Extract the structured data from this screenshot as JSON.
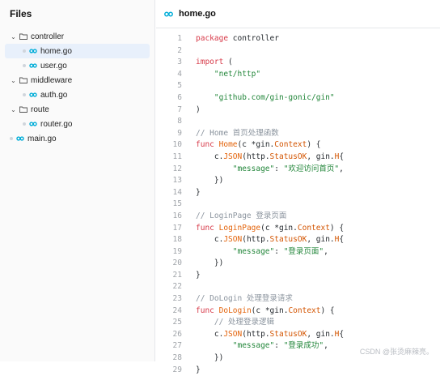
{
  "sidebar": {
    "title": "Files",
    "tree": [
      {
        "kind": "folder",
        "label": "controller",
        "depth": 0,
        "expanded": true
      },
      {
        "kind": "file",
        "label": "home.go",
        "depth": 1,
        "selected": true
      },
      {
        "kind": "file",
        "label": "user.go",
        "depth": 1
      },
      {
        "kind": "folder",
        "label": "middleware",
        "depth": 0,
        "expanded": true
      },
      {
        "kind": "file",
        "label": "auth.go",
        "depth": 1
      },
      {
        "kind": "folder",
        "label": "route",
        "depth": 0,
        "expanded": true
      },
      {
        "kind": "file",
        "label": "router.go",
        "depth": 1
      },
      {
        "kind": "file",
        "label": "main.go",
        "depth": 0
      }
    ]
  },
  "editor": {
    "tab_title": "home.go",
    "lines": [
      [
        [
          "kw",
          "package"
        ],
        [
          "",
          " controller"
        ]
      ],
      [],
      [
        [
          "kw",
          "import"
        ],
        [
          "",
          " ("
        ]
      ],
      [
        [
          "",
          "    "
        ],
        [
          "str",
          "\"net/http\""
        ]
      ],
      [],
      [
        [
          "",
          "    "
        ],
        [
          "str",
          "\"github.com/gin-gonic/gin\""
        ]
      ],
      [
        [
          "",
          ")"
        ]
      ],
      [],
      [
        [
          "cm",
          "// Home 首页处理函数"
        ]
      ],
      [
        [
          "kw",
          "func"
        ],
        [
          "",
          " "
        ],
        [
          "fn",
          "Home"
        ],
        [
          "",
          "(c *gin."
        ],
        [
          "ty",
          "Context"
        ],
        [
          "",
          ") {"
        ]
      ],
      [
        [
          "",
          "    c."
        ],
        [
          "fn",
          "JSON"
        ],
        [
          "",
          "(http."
        ],
        [
          "ty",
          "StatusOK"
        ],
        [
          "",
          ", gin."
        ],
        [
          "ty",
          "H"
        ],
        [
          "",
          "{"
        ]
      ],
      [
        [
          "",
          "        "
        ],
        [
          "str",
          "\"message\""
        ],
        [
          "",
          ": "
        ],
        [
          "str",
          "\"欢迎访问首页\""
        ],
        [
          "",
          ","
        ]
      ],
      [
        [
          "",
          "    })"
        ]
      ],
      [
        [
          "",
          "}"
        ]
      ],
      [],
      [
        [
          "cm",
          "// LoginPage 登录页面"
        ]
      ],
      [
        [
          "kw",
          "func"
        ],
        [
          "",
          " "
        ],
        [
          "fn",
          "LoginPage"
        ],
        [
          "",
          "(c *gin."
        ],
        [
          "ty",
          "Context"
        ],
        [
          "",
          ") {"
        ]
      ],
      [
        [
          "",
          "    c."
        ],
        [
          "fn",
          "JSON"
        ],
        [
          "",
          "(http."
        ],
        [
          "ty",
          "StatusOK"
        ],
        [
          "",
          ", gin."
        ],
        [
          "ty",
          "H"
        ],
        [
          "",
          "{"
        ]
      ],
      [
        [
          "",
          "        "
        ],
        [
          "str",
          "\"message\""
        ],
        [
          "",
          ": "
        ],
        [
          "str",
          "\"登录页面\""
        ],
        [
          "",
          ","
        ]
      ],
      [
        [
          "",
          "    })"
        ]
      ],
      [
        [
          "",
          "}"
        ]
      ],
      [],
      [
        [
          "cm",
          "// DoLogin 处理登录请求"
        ]
      ],
      [
        [
          "kw",
          "func"
        ],
        [
          "",
          " "
        ],
        [
          "fn",
          "DoLogin"
        ],
        [
          "",
          "(c *gin."
        ],
        [
          "ty",
          "Context"
        ],
        [
          "",
          ") {"
        ]
      ],
      [
        [
          "",
          "    "
        ],
        [
          "cm",
          "// 处理登录逻辑"
        ]
      ],
      [
        [
          "",
          "    c."
        ],
        [
          "fn",
          "JSON"
        ],
        [
          "",
          "(http."
        ],
        [
          "ty",
          "StatusOK"
        ],
        [
          "",
          ", gin."
        ],
        [
          "ty",
          "H"
        ],
        [
          "",
          "{"
        ]
      ],
      [
        [
          "",
          "        "
        ],
        [
          "str",
          "\"message\""
        ],
        [
          "",
          ": "
        ],
        [
          "str",
          "\"登录成功\""
        ],
        [
          "",
          ","
        ]
      ],
      [
        [
          "",
          "    })"
        ]
      ],
      [
        [
          "",
          "}"
        ]
      ]
    ]
  },
  "watermark": "CSDN @张烫麻辣亮。",
  "colors": {
    "go_icon": "#00add8",
    "selected_bg": "#e8f0fb"
  }
}
